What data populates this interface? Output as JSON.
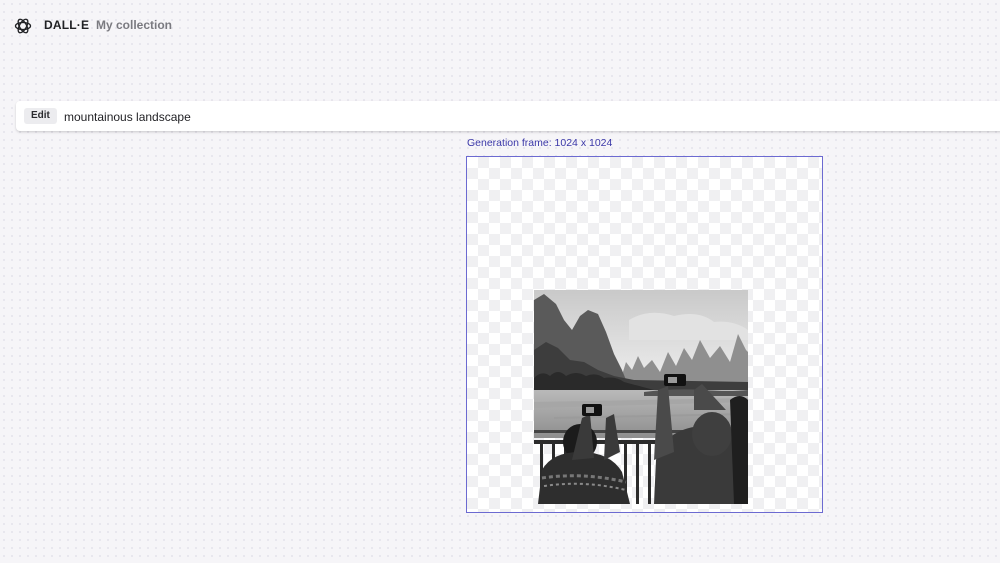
{
  "header": {
    "brand": "DALL·E",
    "nav_collection": "My collection"
  },
  "editor": {
    "mode_badge": "Edit",
    "prompt_value": "mountainous landscape",
    "frame_label": "Generation frame: 1024 x 1024"
  },
  "icons": {
    "logo": "openai-logo-icon"
  },
  "colors": {
    "frame_border": "#6c6ad1",
    "frame_label": "#3b38a8",
    "background": "#f6f5f8"
  }
}
